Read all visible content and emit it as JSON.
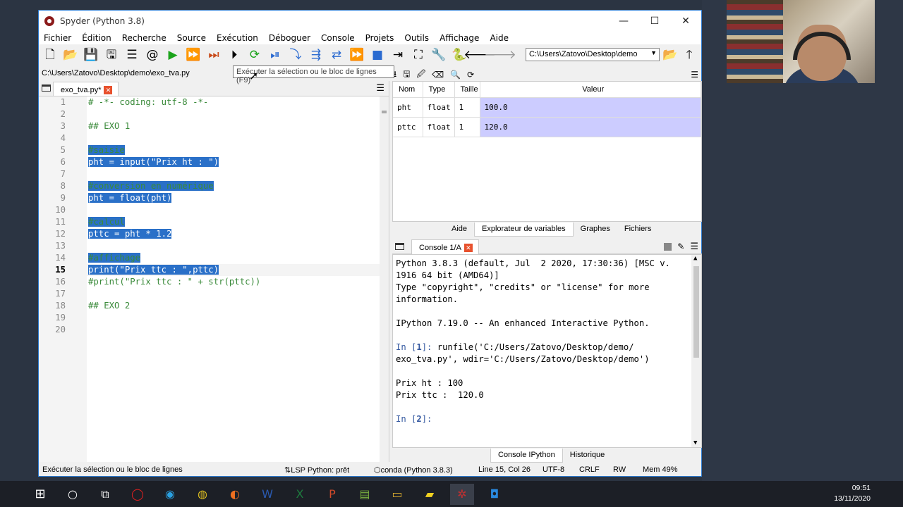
{
  "window": {
    "title": "Spyder (Python 3.8)",
    "controls": {
      "minimize": "—",
      "maximize": "☐",
      "close": "✕"
    }
  },
  "menu": [
    "Fichier",
    "Édition",
    "Recherche",
    "Source",
    "Exécution",
    "Déboguer",
    "Console",
    "Projets",
    "Outils",
    "Affichage",
    "Aide"
  ],
  "toolbar": {
    "working_dir": "C:\\Users\\Zatovo\\Desktop\\demo",
    "tooltip": "Exécuter la sélection ou le bloc de lignes (F9)"
  },
  "editor": {
    "file_path": "C:\\Users\\Zatovo\\Desktop\\demo\\exo_tva.py",
    "tab_label": "exo_tva.py*",
    "current_line": 15,
    "lines": [
      {
        "num": "1",
        "text": "# -*- coding: utf-8 -*-",
        "kind": "cm",
        "sel": false
      },
      {
        "num": "2",
        "text": "",
        "kind": "",
        "sel": false
      },
      {
        "num": "3",
        "text": "## EXO 1",
        "kind": "cm",
        "sel": false
      },
      {
        "num": "4",
        "text": "",
        "kind": "",
        "sel": false
      },
      {
        "num": "5",
        "text": "#saisie",
        "kind": "cm",
        "sel": true
      },
      {
        "num": "6",
        "text": "pht = input(\"Prix ht : \")",
        "kind": "",
        "sel": true
      },
      {
        "num": "7",
        "text": "",
        "kind": "",
        "sel": false
      },
      {
        "num": "8",
        "text": "#conversion en numérique",
        "kind": "cm",
        "sel": true
      },
      {
        "num": "9",
        "text": "pht = float(pht)",
        "kind": "",
        "sel": true
      },
      {
        "num": "10",
        "text": "",
        "kind": "",
        "sel": false
      },
      {
        "num": "11",
        "text": "#calcul",
        "kind": "cm",
        "sel": true
      },
      {
        "num": "12",
        "text": "pttc = pht * 1.2",
        "kind": "",
        "sel": true
      },
      {
        "num": "13",
        "text": "",
        "kind": "",
        "sel": false
      },
      {
        "num": "14",
        "text": "#affichage",
        "kind": "cm",
        "sel": true
      },
      {
        "num": "15",
        "text": "print(\"Prix ttc : \",pttc)",
        "kind": "",
        "sel": true
      },
      {
        "num": "16",
        "text": "#print(\"Prix ttc : \" + str(pttc))",
        "kind": "cm",
        "sel": false
      },
      {
        "num": "17",
        "text": "",
        "kind": "",
        "sel": false
      },
      {
        "num": "18",
        "text": "## EXO 2",
        "kind": "cm",
        "sel": false
      },
      {
        "num": "19",
        "text": "",
        "kind": "",
        "sel": false
      },
      {
        "num": "20",
        "text": "",
        "kind": "",
        "sel": false
      }
    ]
  },
  "variables": {
    "headers": [
      "Nom",
      "Type",
      "Taille",
      "Valeur"
    ],
    "rows": [
      {
        "name": "pht",
        "type": "float",
        "size": "1",
        "value": "100.0"
      },
      {
        "name": "pttc",
        "type": "float",
        "size": "1",
        "value": "120.0"
      }
    ]
  },
  "upper_tabs": [
    "Aide",
    "Explorateur de variables",
    "Graphes",
    "Fichiers"
  ],
  "console": {
    "tab_label": "Console 1/A",
    "lines": [
      "Python 3.8.3 (default, Jul  2 2020, 17:30:36) [MSC v.",
      "1916 64 bit (AMD64)]",
      "Type \"copyright\", \"credits\" or \"license\" for more",
      "information.",
      "",
      "IPython 7.19.0 -- An enhanced Interactive Python.",
      "",
      "In [1]: runfile('C:/Users/Zatovo/Desktop/demo/",
      "exo_tva.py', wdir='C:/Users/Zatovo/Desktop/demo')",
      "",
      "Prix ht : 100",
      "Prix ttc :  120.0",
      "",
      "In [2]:"
    ]
  },
  "lower_tabs": [
    "Console IPython",
    "Historique"
  ],
  "status": {
    "message": "Exécuter la sélection ou le bloc de lignes",
    "lsp": "LSP Python: prêt",
    "env": "conda (Python 3.8.3)",
    "position": "Line 15, Col 26",
    "encoding": "UTF-8",
    "eol": "CRLF",
    "mode": "RW",
    "memory": "Mem 49%"
  },
  "clock": {
    "time": "09:51",
    "date": "13/11/2020"
  }
}
